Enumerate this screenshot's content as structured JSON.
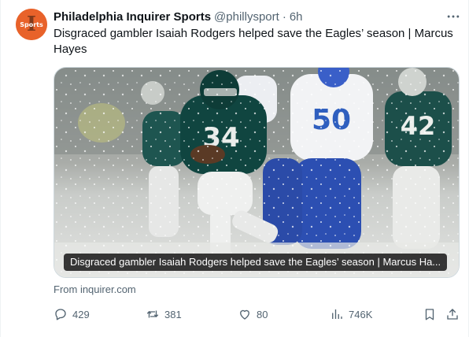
{
  "author": {
    "display_name": "Philadelphia Inquirer Sports",
    "handle": "@phillysport",
    "separator": "·",
    "time": "6h",
    "avatar_text": "Sports",
    "avatar_color": "#e8622a"
  },
  "tweet": {
    "text": "Disgraced gambler Isaiah Rodgers helped save the Eagles’ season | Marcus Hayes"
  },
  "card": {
    "image_icon": "football-game-photo",
    "caption": "Disgraced gambler Isaiah Rodgers helped save the Eagles’ season | Marcus Ha...",
    "source": "From inquirer.com"
  },
  "actions": {
    "reply_count": "429",
    "repost_count": "381",
    "like_count": "80",
    "views_count": "746K"
  },
  "colors": {
    "text": "#0f1419",
    "secondary": "#536471",
    "border": "#cfd9de"
  }
}
